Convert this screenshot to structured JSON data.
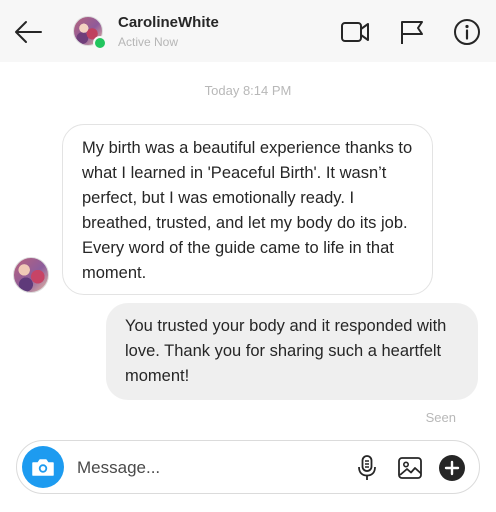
{
  "header": {
    "contact_name": "CarolineWhite",
    "status": "Active Now",
    "icons": [
      "back-arrow-icon",
      "video-camera-icon",
      "flag-icon",
      "info-icon"
    ]
  },
  "conversation": {
    "timestamp": "Today 8:14 PM",
    "messages": [
      {
        "direction": "incoming",
        "text": "My birth was a beautiful experience thanks to what I learned in 'Peaceful Birth'. It wasn’t perfect, but I was emotionally ready. I breathed, trusted, and let my body do its job. Every word of the guide came to life in that moment."
      },
      {
        "direction": "outgoing",
        "text": "You trusted your body and it responded with love. Thank you for sharing such a heartfelt moment!"
      }
    ],
    "read_receipt": "Seen"
  },
  "composer": {
    "placeholder": "Message...",
    "value": "",
    "icons": [
      "camera-icon",
      "microphone-icon",
      "image-icon",
      "plus-icon"
    ],
    "camera_color": "#1d9bf0"
  },
  "colors": {
    "online_indicator": "#22c55e",
    "outgoing_bubble": "#efefef"
  }
}
